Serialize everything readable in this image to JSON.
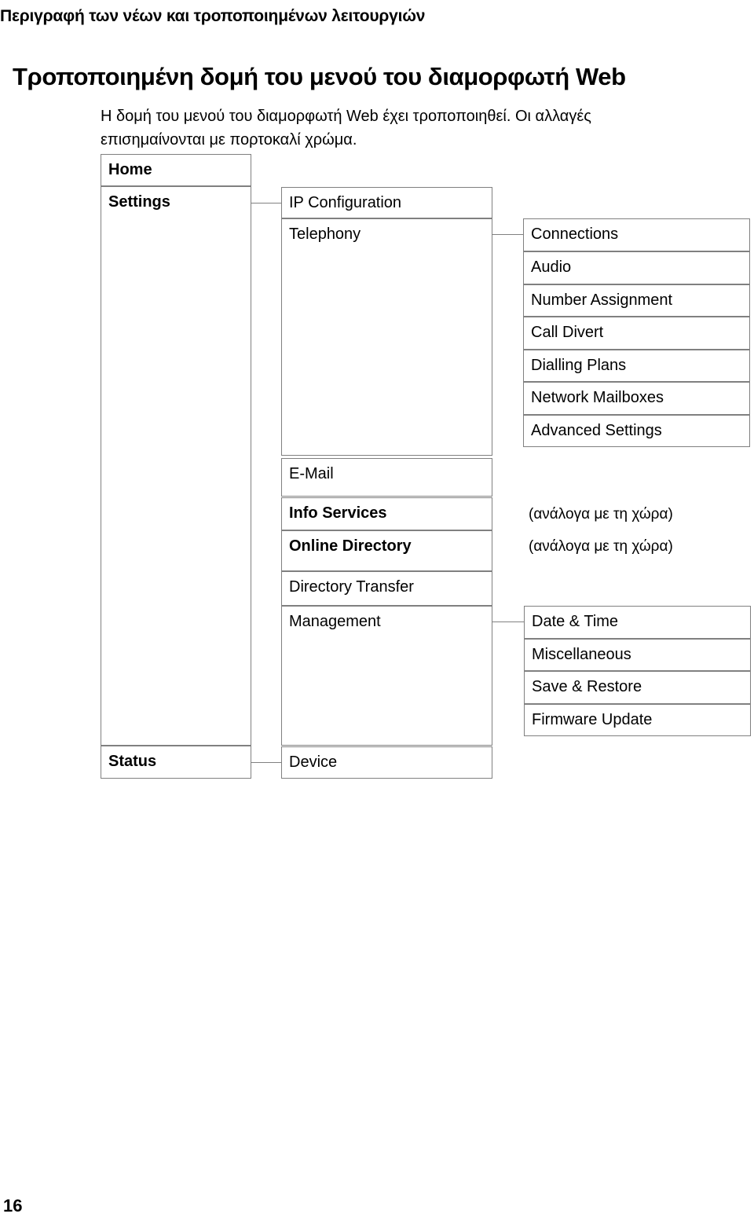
{
  "header": {
    "running_head": "Περιγραφή των νέων και τροποποιημένων λειτουργιών",
    "title": "Τροποποιημένη δομή του μενού του διαμορφωτή Web",
    "intro": "Η δομή του μενού του διαμορφωτή Web έχει τροποποιηθεί. Οι αλλαγές επισημαίνονται με πορτοκαλί χρώμα."
  },
  "footer": {
    "page_number": "16"
  },
  "diagram": {
    "type": "menu-tree",
    "level1": [
      {
        "label": "Home",
        "changed": true
      },
      {
        "label": "Settings",
        "changed": true
      },
      {
        "label": "Status",
        "changed": true
      }
    ],
    "settings_children": [
      {
        "label": "IP Configuration",
        "changed": false
      },
      {
        "label": "Telephony",
        "changed": false
      },
      {
        "label": "E-Mail",
        "changed": false
      },
      {
        "label": "Info Services",
        "changed": true
      },
      {
        "label": "Online Directory",
        "changed": true
      },
      {
        "label": "Directory Transfer",
        "changed": false
      },
      {
        "label": "Management",
        "changed": false
      }
    ],
    "telephony_children": [
      {
        "label": "Connections",
        "changed": false
      },
      {
        "label": "Audio",
        "changed": false
      },
      {
        "label": "Number Assignment",
        "changed": false
      },
      {
        "label": "Call Divert",
        "changed": false
      },
      {
        "label": "Dialling Plans",
        "changed": false
      },
      {
        "label": "Network Mailboxes",
        "changed": false
      },
      {
        "label": "Advanced Settings",
        "changed": false
      }
    ],
    "management_children": [
      {
        "label": "Date & Time",
        "changed": false
      },
      {
        "label": "Miscellaneous",
        "changed": false
      },
      {
        "label": "Save & Restore",
        "changed": false
      },
      {
        "label": "Firmware Update",
        "changed": false
      }
    ],
    "status_children": [
      {
        "label": "Device",
        "changed": false
      }
    ],
    "notes": [
      {
        "text": "(ανάλογα με τη χώρα)",
        "for": "Info Services"
      },
      {
        "text": "(ανάλογα με τη χώρα)",
        "for": "Online Directory"
      }
    ]
  }
}
